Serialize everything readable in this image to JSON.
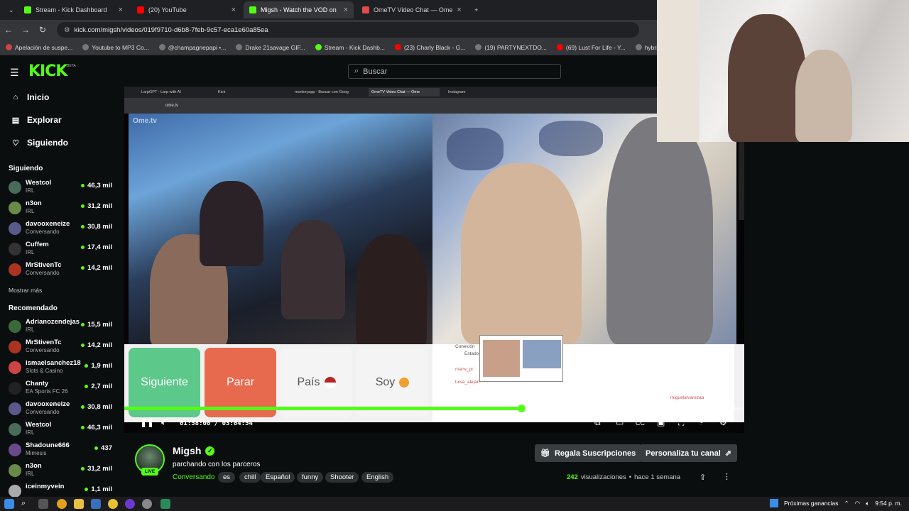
{
  "browser": {
    "tabs": [
      {
        "label": "Stream - Kick Dashboard",
        "color": "#53fc18"
      },
      {
        "label": "(20) YouTube",
        "color": "#ff0000"
      },
      {
        "label": "Migsh - Watch the VOD on",
        "color": "#53fc18"
      },
      {
        "label": "OmeTV Video Chat — Ome",
        "color": "#e04a4a"
      }
    ],
    "url": "kick.com/migsh/videos/019f9710-d6b8-7feb-9c57-eca1e60a85ea",
    "bookmarks": [
      "Apelación de suspe...",
      "Youtube to MP3 Co...",
      "@champagnepapi •...",
      "Drake 21savage GIF...",
      "Stream - Kick Dashb...",
      "(23) Charly Black - G...",
      "(19) PARTYNEXTDO...",
      "(69) Lust For Life - Y...",
      "hybriidbox.app/spot..."
    ]
  },
  "header": {
    "logo": "KICK",
    "beta": "BETA",
    "search_placeholder": "Buscar"
  },
  "sidebar": {
    "nav": [
      "Inicio",
      "Explorar",
      "Siguiendo"
    ],
    "following_title": "Siguiendo",
    "following": [
      {
        "name": "Westcol",
        "category": "IRL",
        "viewers": "46,3 mil",
        "color": "#4a6a5a"
      },
      {
        "name": "n3on",
        "category": "IRL",
        "viewers": "31,2 mil",
        "color": "#6a8a4a"
      },
      {
        "name": "davooxeneize",
        "category": "Conversando",
        "viewers": "30,8 mil",
        "color": "#5a5a8a"
      },
      {
        "name": "Cuffem",
        "category": "IRL",
        "viewers": "17,4 mil",
        "color": "#333"
      },
      {
        "name": "MrStivenTc",
        "category": "Conversando",
        "viewers": "14,2 mil",
        "color": "#aa3322"
      }
    ],
    "show_more": "Mostrar más",
    "recommended_title": "Recomendado",
    "recommended": [
      {
        "name": "Adrianozendejas",
        "category": "IRL",
        "viewers": "15,5 mil",
        "color": "#3a6a3a"
      },
      {
        "name": "MrStivenTc",
        "category": "Conversando",
        "viewers": "14,2 mil",
        "color": "#aa3322"
      },
      {
        "name": "ismaelsanchez18",
        "category": "Slots & Casino",
        "viewers": "1,9 mil",
        "color": "#cc4444"
      },
      {
        "name": "Chanty",
        "category": "EA Sports FC 26",
        "viewers": "2,7 mil",
        "color": "#222"
      },
      {
        "name": "davooxeneize",
        "category": "Conversando",
        "viewers": "30,8 mil",
        "color": "#5a5a8a"
      },
      {
        "name": "Westcol",
        "category": "IRL",
        "viewers": "46,3 mil",
        "color": "#4a6a5a"
      },
      {
        "name": "Shadoune666",
        "category": "Mimesis",
        "viewers": "437",
        "color": "#6a4a8a"
      },
      {
        "name": "n3on",
        "category": "IRL",
        "viewers": "31,2 mil",
        "color": "#6a8a4a"
      },
      {
        "name": "iceinmyvein",
        "category": "",
        "viewers": "1,1 mil",
        "color": "#aaa"
      }
    ]
  },
  "video": {
    "inner_tabs": [
      "LarpGPT - Larp with AI",
      "Kick",
      "monkeyapp - Buscar con Goog",
      "OmeTV Video Chat — Ome",
      "Instagram"
    ],
    "inner_url": "ome.tv",
    "ome_logo": "Ome.tv",
    "buttons": {
      "next": "Siguiente",
      "stop": "Parar",
      "country": "País",
      "iam": "Soy"
    },
    "chat": [
      "Conexión",
      "Estado",
      "marw_pr",
      "luisa_alejan",
      "miguelalvarezaa"
    ],
    "current_time": "01:58:00",
    "duration": "03:04:54",
    "progress": 0.64
  },
  "stream": {
    "streamer": "Migsh",
    "live": "LIVE",
    "title": "parchando con los parceros",
    "category": "Conversando",
    "tags": [
      "es",
      "chill",
      "Español",
      "funny",
      "Shooter",
      "English"
    ],
    "gift_button": "Regala Suscripciones",
    "customize_button": "Personaliza tu canal",
    "views_count": "242",
    "views_label": "visualizaciones",
    "time_ago": "hace 1 semana"
  },
  "taskbar": {
    "news": "Próximas ganancias",
    "time": "9:54 p. m."
  }
}
